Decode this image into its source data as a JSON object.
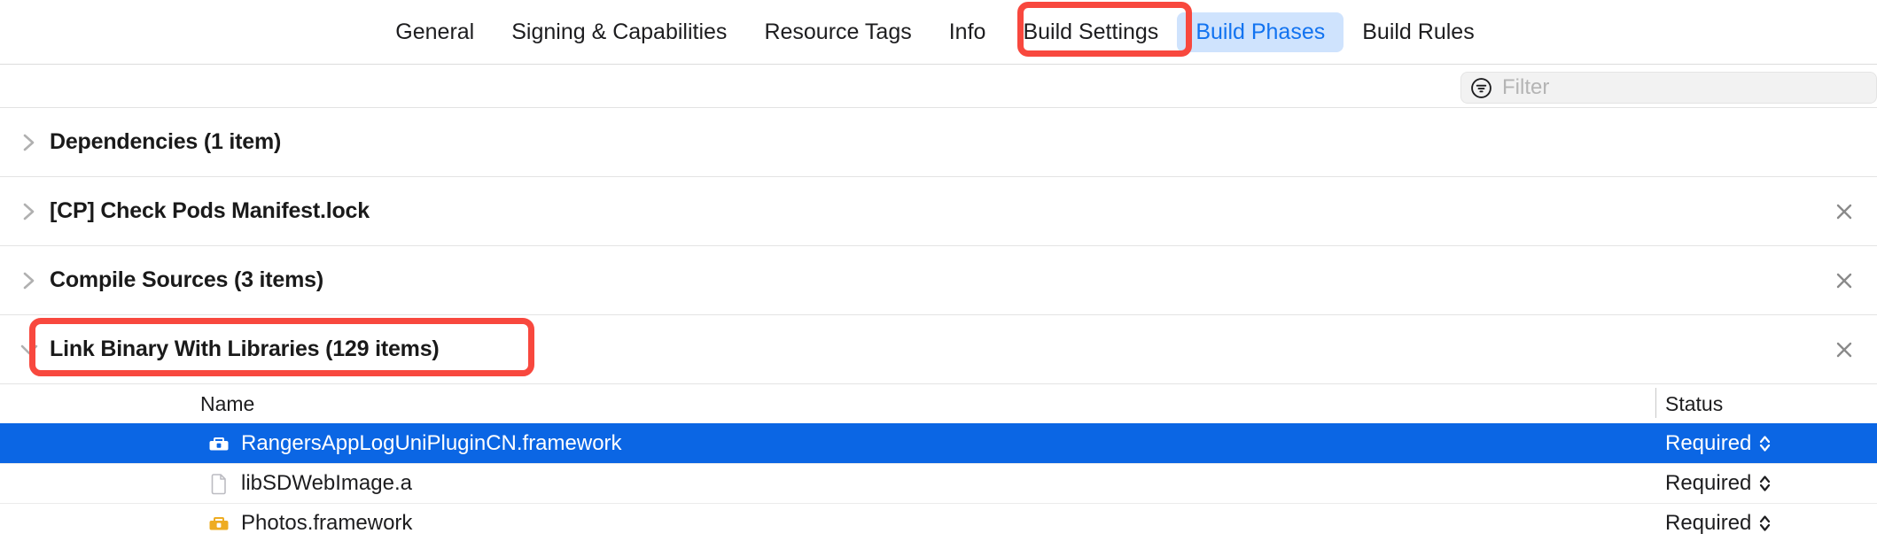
{
  "tabbar": {
    "tabs": [
      {
        "label": "General",
        "active": false
      },
      {
        "label": "Signing & Capabilities",
        "active": false
      },
      {
        "label": "Resource Tags",
        "active": false
      },
      {
        "label": "Info",
        "active": false
      },
      {
        "label": "Build Settings",
        "active": false
      },
      {
        "label": "Build Phases",
        "active": true
      },
      {
        "label": "Build Rules",
        "active": false
      }
    ],
    "active_tab": "Build Phases",
    "active_tab_bg": "#cfe3fd",
    "active_tab_color": "#1273f0"
  },
  "annotations": {
    "color": "#f8483e",
    "tab_target": "Build Phases",
    "phase_target": "Link Binary With Libraries (129 items)"
  },
  "filter": {
    "placeholder": "Filter",
    "value": "",
    "icon": "filter-circle-icon"
  },
  "phases": [
    {
      "title": "Dependencies (1 item)",
      "expanded": false,
      "chevron": "chevron-right-icon",
      "removable": false
    },
    {
      "title": "[CP] Check Pods Manifest.lock",
      "expanded": false,
      "chevron": "chevron-right-icon",
      "removable": true
    },
    {
      "title": "Compile Sources (3 items)",
      "expanded": false,
      "chevron": "chevron-right-icon",
      "removable": true
    },
    {
      "title": "Link Binary With Libraries (129 items)",
      "expanded": true,
      "chevron": "chevron-down-icon",
      "removable": true
    }
  ],
  "library_table": {
    "columns": [
      "Name",
      "Status"
    ],
    "rows": [
      {
        "name": "RangersAppLogUniPluginCN.framework",
        "status": "Required",
        "icon": "framework-toolbox-icon",
        "icon_color": "#ffffff",
        "selected": true
      },
      {
        "name": "libSDWebImage.a",
        "status": "Required",
        "icon": "static-library-document-icon",
        "icon_color": "#b8b8bd",
        "selected": false
      },
      {
        "name": "Photos.framework",
        "status": "Required",
        "icon": "framework-toolbox-icon",
        "icon_color": "#eeac22",
        "selected": false
      }
    ],
    "selection_color": "#0b66e4"
  }
}
